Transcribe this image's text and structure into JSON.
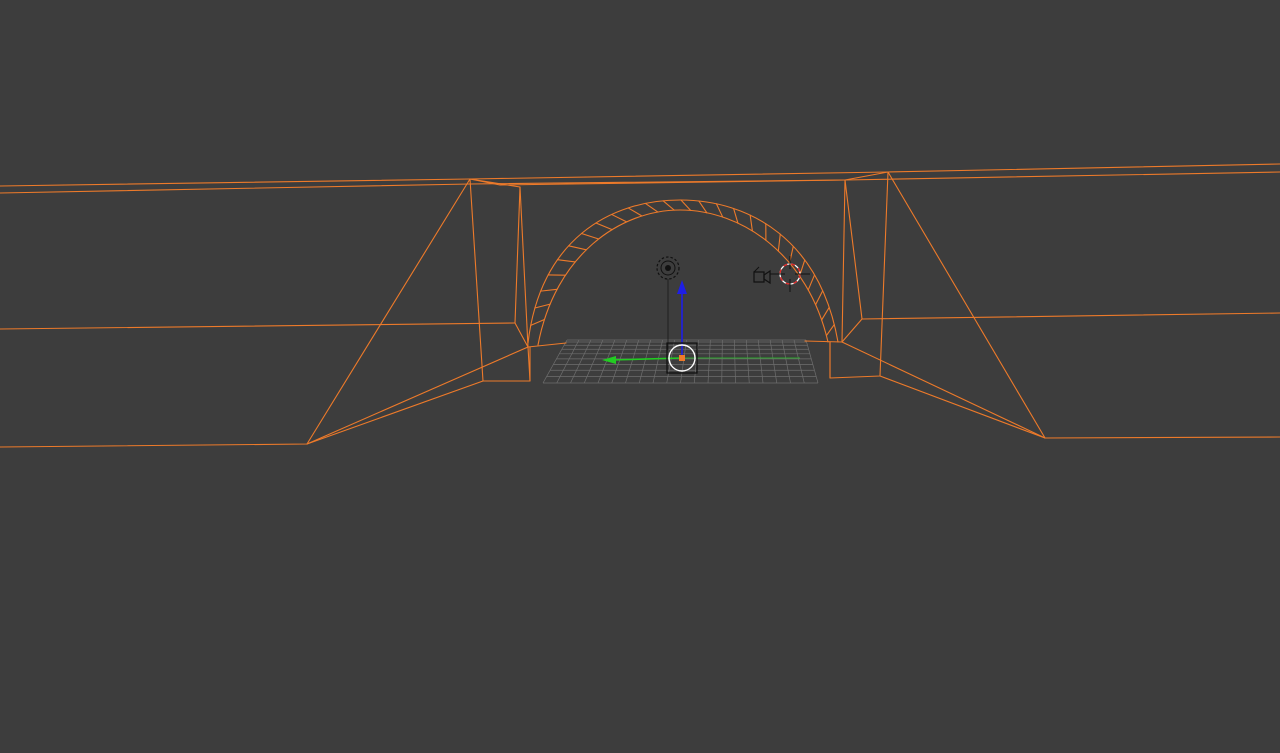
{
  "viewport": {
    "background": "#3d3d3d",
    "selected_wire_color": "#ed7a2a",
    "grid_color": "#6e6e6e"
  },
  "gizmo": {
    "x_axis_color": "#22cc22",
    "z_axis_color": "#1e1ee6",
    "origin_color": "#ed7a2a"
  },
  "icons": {
    "lamp": "lamp-icon",
    "camera": "camera-icon",
    "cursor": "3d-cursor-icon"
  }
}
